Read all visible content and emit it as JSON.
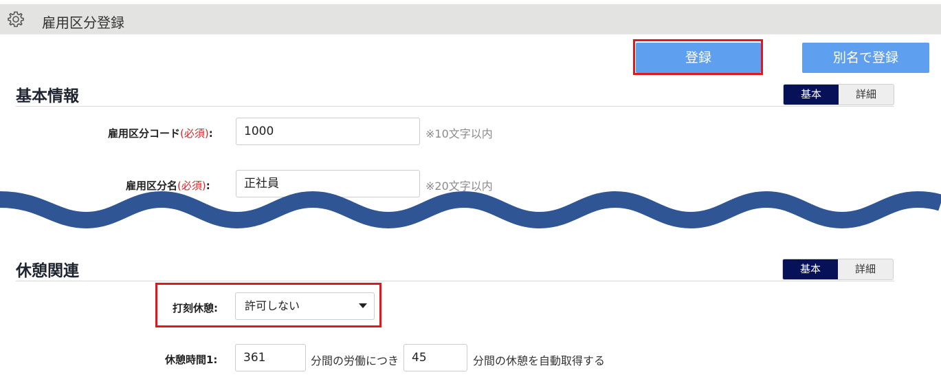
{
  "header": {
    "title": "雇用区分登録",
    "icon": "gear-icon"
  },
  "toolbar": {
    "register_label": "登録",
    "save_as_label": "別名で登録"
  },
  "sections": {
    "basic_info": {
      "title": "基本情報",
      "toggle": {
        "basic": "基本",
        "detail": "詳細",
        "selected": "基本"
      },
      "fields": {
        "code": {
          "label": "雇用区分コード",
          "required": "(必須)",
          "colon": ":",
          "value": "1000",
          "hint": "※10文字以内"
        },
        "name": {
          "label": "雇用区分名",
          "required": "(必須)",
          "colon": ":",
          "value": "正社員",
          "hint": "※20文字以内"
        }
      }
    },
    "break": {
      "title": "休憩関連",
      "toggle": {
        "basic": "基本",
        "detail": "詳細",
        "selected": "基本"
      },
      "stamp_break": {
        "label": "打刻休憩:",
        "value": "許可しない"
      },
      "break_time_1": {
        "label": "休憩時間1:",
        "work_minutes": "361",
        "text_mid": "分間の労働につき",
        "break_minutes": "45",
        "text_end": "分間の休憩を自動取得する"
      }
    }
  },
  "colors": {
    "accent": "#5f9ff0",
    "toggle_active": "#061157",
    "highlight": "#e3171b",
    "wave": "#2f5595",
    "required": "#d4252a"
  }
}
